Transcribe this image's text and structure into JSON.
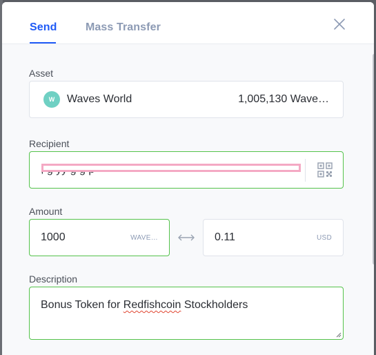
{
  "tabs": {
    "send": "Send",
    "mass_transfer": "Mass Transfer"
  },
  "asset": {
    "label": "Asset",
    "icon_letter": "W",
    "name": "Waves World",
    "balance": "1,005,130  Wave…"
  },
  "recipient": {
    "label": "Recipient",
    "value_partial": ", g       yy g g                                                   p"
  },
  "amount": {
    "label": "Amount",
    "value": "1000",
    "unit": "WAVE…",
    "usd_value": "0.11",
    "usd_unit": "USD"
  },
  "description": {
    "label": "Description",
    "text_before": "Bonus Token for ",
    "text_misspelled": "Redfishcoin",
    "text_after": " Stockholders"
  },
  "colors": {
    "accent": "#1f5af6",
    "inactive_tab": "#8c9ab4",
    "valid_border": "#53c24a",
    "asset_icon": "#6fd0c3",
    "redaction": "#f4a9c4"
  },
  "icons": {
    "close": "close-icon",
    "qr": "qr-code-icon",
    "swap": "swap-arrows-icon"
  }
}
